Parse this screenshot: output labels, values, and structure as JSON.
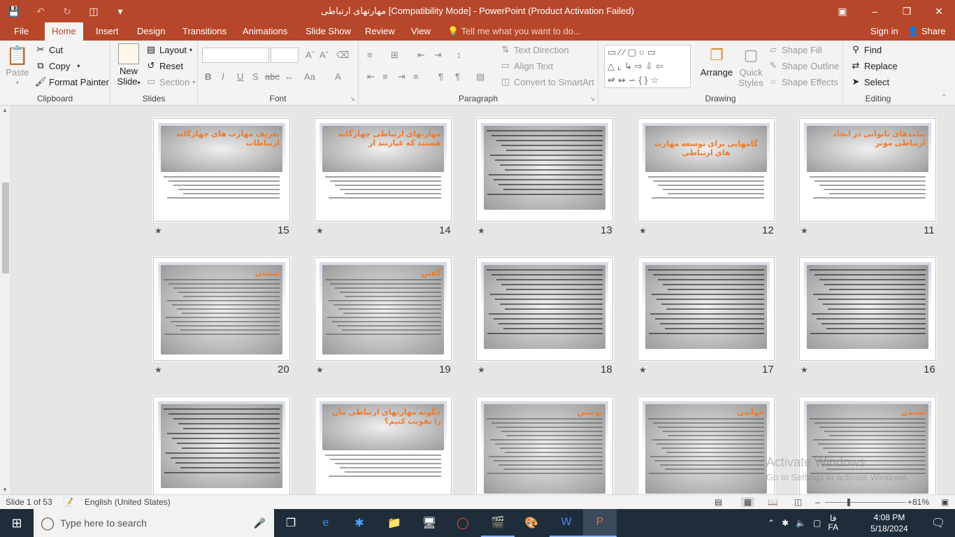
{
  "window": {
    "title": "مهارتهای ارتباطی [Compatibility Mode] - PowerPoint (Product Activation Failed)",
    "qat": [
      "save-icon",
      "undo-icon",
      "redo-icon",
      "start-from-beginning-icon",
      "customize-icon"
    ]
  },
  "tabs": [
    "File",
    "Home",
    "Insert",
    "Design",
    "Transitions",
    "Animations",
    "Slide Show",
    "Review",
    "View"
  ],
  "tell_me": "Tell me what you want to do...",
  "sign_in": "Sign in",
  "share": "Share",
  "ribbon": {
    "clipboard": {
      "paste": "Paste",
      "cut": "Cut",
      "copy": "Copy",
      "format_painter": "Format Painter",
      "label": "Clipboard"
    },
    "slides": {
      "new_slide_1": "New",
      "new_slide_2": "Slide",
      "layout": "Layout",
      "reset": "Reset",
      "section": "Section",
      "label": "Slides"
    },
    "font": {
      "label": "Font",
      "bold": "B",
      "italic": "I",
      "underline": "U",
      "strike": "S",
      "abc": "abc",
      "aa": "Aa",
      "a": "A"
    },
    "paragraph": {
      "label": "Paragraph",
      "text_direction": "Text Direction",
      "align_text": "Align Text",
      "smartart": "Convert to SmartArt"
    },
    "drawing": {
      "label": "Drawing",
      "arrange": "Arrange",
      "quick_styles_1": "Quick",
      "quick_styles_2": "Styles",
      "shape_fill": "Shape Fill",
      "shape_outline": "Shape Outline",
      "shape_effects": "Shape Effects"
    },
    "editing": {
      "label": "Editing",
      "find": "Find",
      "replace": "Replace",
      "select": "Select"
    }
  },
  "slides": [
    {
      "num": "11",
      "title": "پیامدهای ناتوانی در ایجاد ارتباطی موثر",
      "layout": "title-text"
    },
    {
      "num": "12",
      "title": "گامهایی برای توسعه مهارت های ارتباطی",
      "layout": "title-center"
    },
    {
      "num": "13",
      "title": "",
      "layout": "full"
    },
    {
      "num": "14",
      "title": "مهارتهای ارتباطی چهارگانه هستند که عبارتند از",
      "layout": "title-text"
    },
    {
      "num": "15",
      "title": "تعریف مهارت های چهارگانه ارتباطات",
      "layout": "title-text"
    },
    {
      "num": "16",
      "title": "",
      "layout": "full"
    },
    {
      "num": "17",
      "title": "",
      "layout": "full"
    },
    {
      "num": "18",
      "title": "",
      "layout": "full"
    },
    {
      "num": "19",
      "title": "گفتن",
      "layout": "title-small"
    },
    {
      "num": "20",
      "title": "شنیدن",
      "layout": "title-small"
    },
    {
      "num": "",
      "title": "شنیدن",
      "layout": "title-small"
    },
    {
      "num": "",
      "title": "خواندن",
      "layout": "title-small"
    },
    {
      "num": "",
      "title": "نوشتن",
      "layout": "title-small"
    },
    {
      "num": "",
      "title": "چگونه مهارتهای ارتباطی مان را تقویت کنیم؟",
      "layout": "title-text"
    },
    {
      "num": "",
      "title": "",
      "layout": "full"
    }
  ],
  "watermark": {
    "line1": "Activate Windows",
    "line2": "Go to Settings to activate Windows."
  },
  "status": {
    "slide_count": "Slide 1 of 53",
    "language": "English (United States)",
    "zoom": "81%"
  },
  "taskbar": {
    "search_placeholder": "Type here to search",
    "time": "4:08 PM",
    "date": "5/18/2024",
    "lang": "FA",
    "lang_sub": "فا"
  }
}
